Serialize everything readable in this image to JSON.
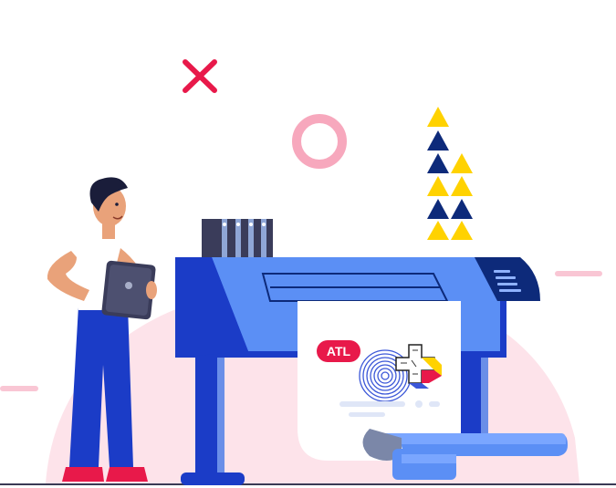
{
  "illustration": {
    "badge_label": "ATL",
    "colors": {
      "primary_blue": "#1b3cc7",
      "light_blue": "#5b8ff5",
      "navy": "#0d2a7a",
      "pink_bg": "#fde3ea",
      "accent_red": "#e8194a",
      "yellow": "#ffd200",
      "skin": "#e9a27a"
    },
    "icons": [
      "close-icon",
      "ring-shape",
      "triangle-stack",
      "printer",
      "person-with-tablet"
    ]
  }
}
